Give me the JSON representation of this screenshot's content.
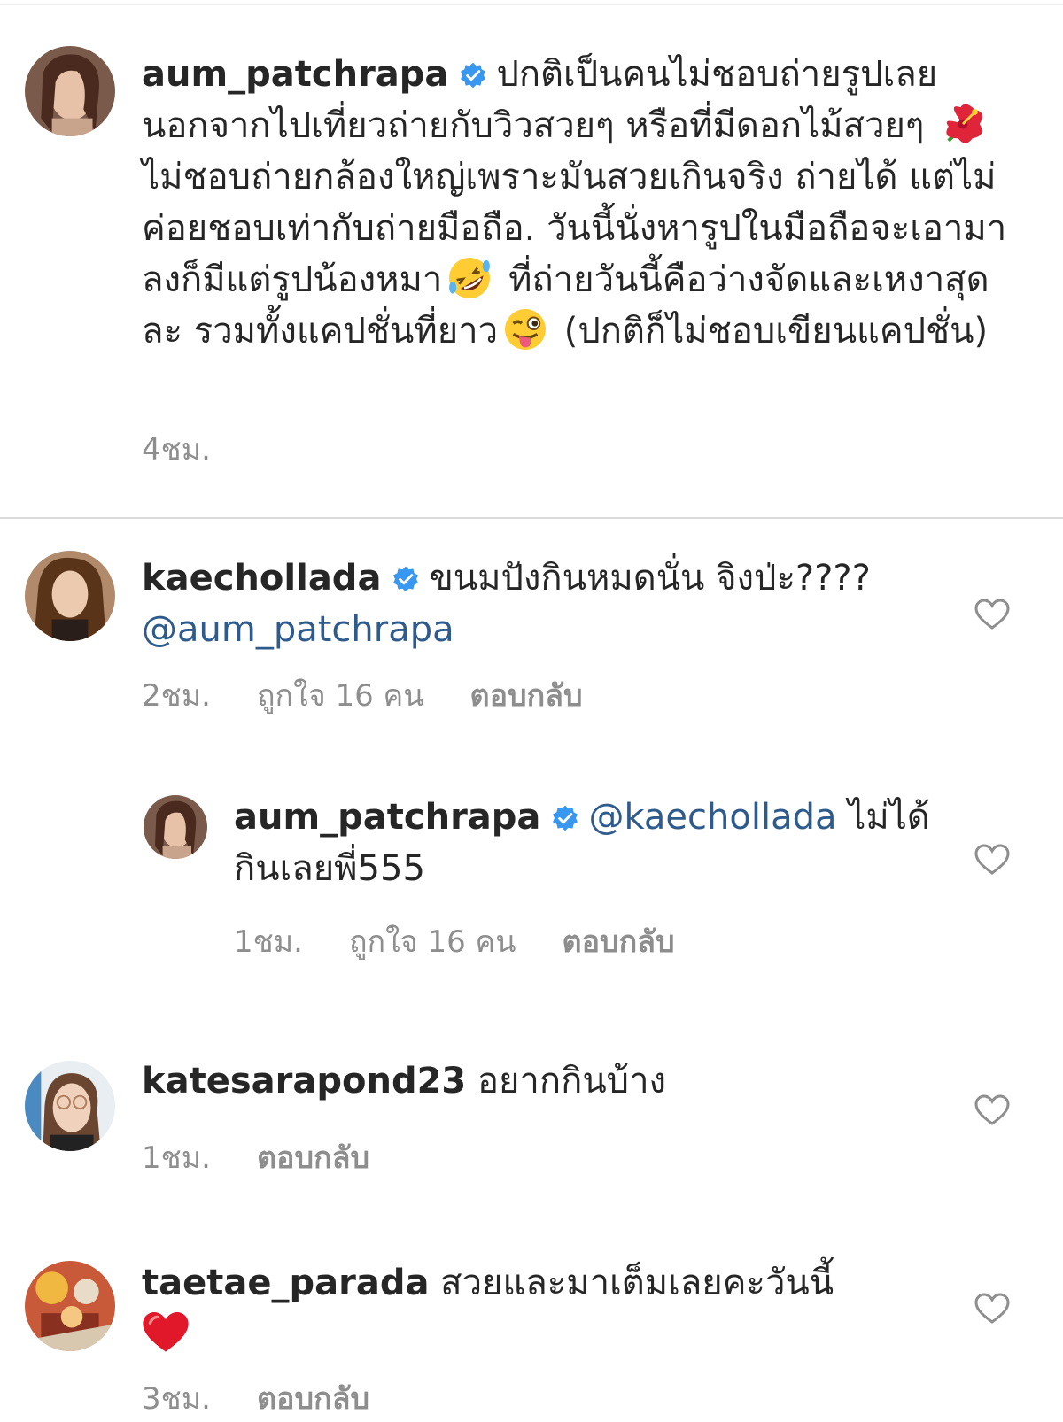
{
  "caption": {
    "username": "aum_patchrapa",
    "text_part1": "ปกติเป็นคนไม่ชอบถ่ายรูปเลย นอกจากไปเที่ยวถ่ายกับวิวสวยๆ หรือที่มีดอกไม้สวยๆ",
    "text_part2": "ไม่ชอบถ่ายกล้องใหญ่เพราะมันสวยเกินจริง ถ่ายได้ แต่ไม่ค่อยชอบเท่ากับถ่ายมือถือ. วันนี้นั่งหารูปในมือถือจะเอามาลงก็มีแต่รูปน้องหมา",
    "text_part3": "ที่ถ่ายวันนี้คือว่างจัดและเหงาสุดละ รวมทั้งแคปชั่นที่ยาว",
    "text_part4": "(ปกติก็ไม่ชอบเขียนแคปชั่น)",
    "time": "4ชม.",
    "emoji_1": "hibiscus-emoji",
    "emoji_2": "rofl-emoji",
    "emoji_3": "winking-tongue-emoji"
  },
  "comments": [
    {
      "username": "kaechollada",
      "text": "ขนมปังกินหมดนั่น จิงป่ะ????",
      "mention": "@aum_patchrapa",
      "time": "2ชม.",
      "likes": "ถูกใจ 16 คน",
      "reply": "ตอบกลับ"
    },
    {
      "username": "aum_patchrapa",
      "mention": "@kaechollada",
      "text": "ไม่ได้กินเลยพี่555",
      "time": "1ชม.",
      "likes": "ถูกใจ 16 คน",
      "reply": "ตอบกลับ"
    },
    {
      "username": "katesarapond23",
      "text": "อยากกินบ้าง",
      "time": "1ชม.",
      "reply": "ตอบกลับ"
    },
    {
      "username": "taetae_parada",
      "text": "สวยและมาเต็มเลยคะวันนี้",
      "emoji": "red-heart-emoji",
      "time": "3ชม.",
      "reply": "ตอบกลับ"
    }
  ],
  "colors": {
    "text": "#262626",
    "muted": "#8e8e8e",
    "mention": "#2f5b8c",
    "verified": "#3897f0",
    "divider": "#dbdbdb"
  }
}
